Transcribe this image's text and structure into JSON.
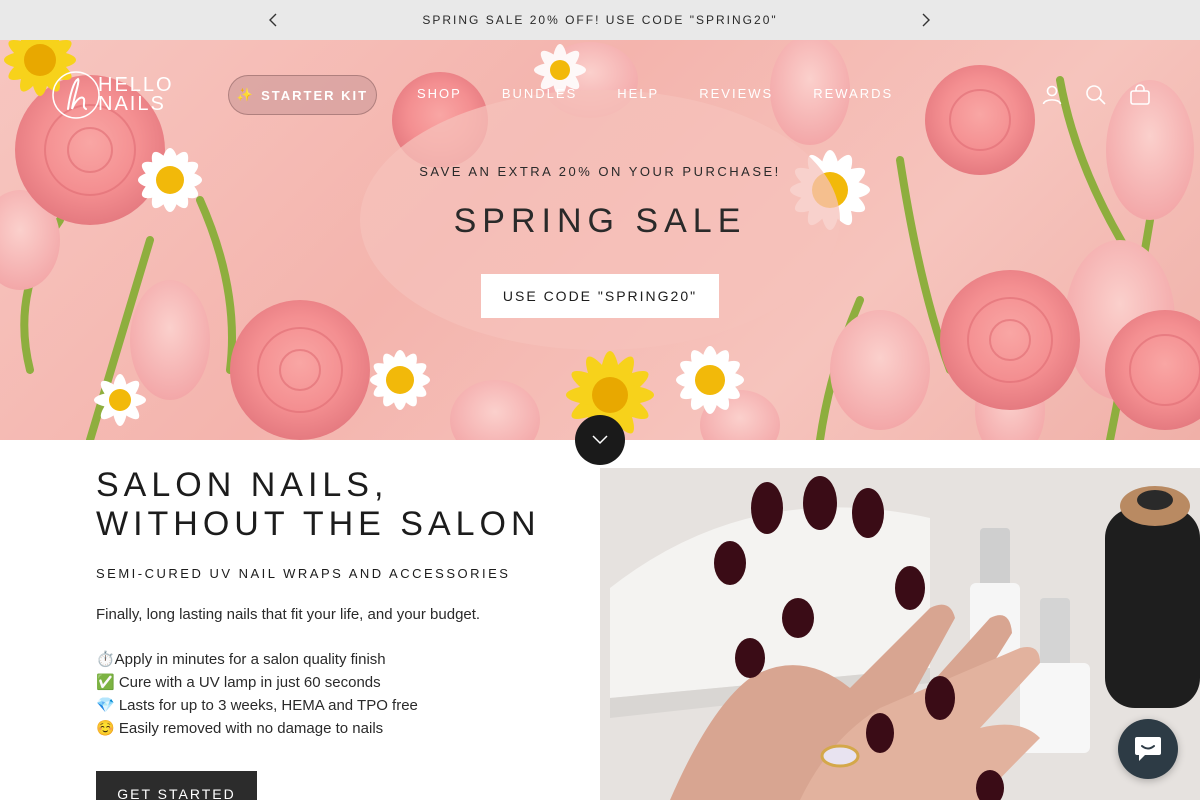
{
  "announcement": {
    "text": "SPRING SALE 20% OFF! USE CODE \"SPRING20\"",
    "prev_icon": "chevron-left-icon",
    "next_icon": "chevron-right-icon"
  },
  "header": {
    "logo_line1": "HELLO",
    "logo_line2": "NAILS",
    "starter_kit": {
      "icon": "✨",
      "label": "STARTER KIT"
    },
    "nav": [
      {
        "label": "SHOP"
      },
      {
        "label": "BUNDLES"
      },
      {
        "label": "HELP"
      },
      {
        "label": "REVIEWS"
      },
      {
        "label": "REWARDS"
      }
    ],
    "icons": [
      "account-icon",
      "search-icon",
      "cart-icon"
    ]
  },
  "hero": {
    "subtitle": "SAVE AN EXTRA 20% ON YOUR PURCHASE!",
    "title": "SPRING SALE",
    "cta": "USE CODE \"SPRING20\""
  },
  "content": {
    "title_line1": "SALON NAILS,",
    "title_line2": "WITHOUT THE SALON",
    "subtitle": "SEMI-CURED UV NAIL WRAPS AND ACCESSORIES",
    "description": "Finally, long lasting nails that fit your life, and your budget.",
    "features": [
      "⏱️Apply in minutes for a salon quality finish",
      "✅ Cure with a UV lamp in just 60 seconds",
      "💎 Lasts for up to 3 weeks, HEMA and TPO free",
      "☺️ Easily removed with no damage to nails"
    ],
    "cta": "GET STARTED"
  },
  "colors": {
    "announcement_bg": "#e9e9e9",
    "hero_bg": "#f4b4ad",
    "dark_button": "#2c2c2c",
    "chat_bg": "#2d3b45"
  }
}
